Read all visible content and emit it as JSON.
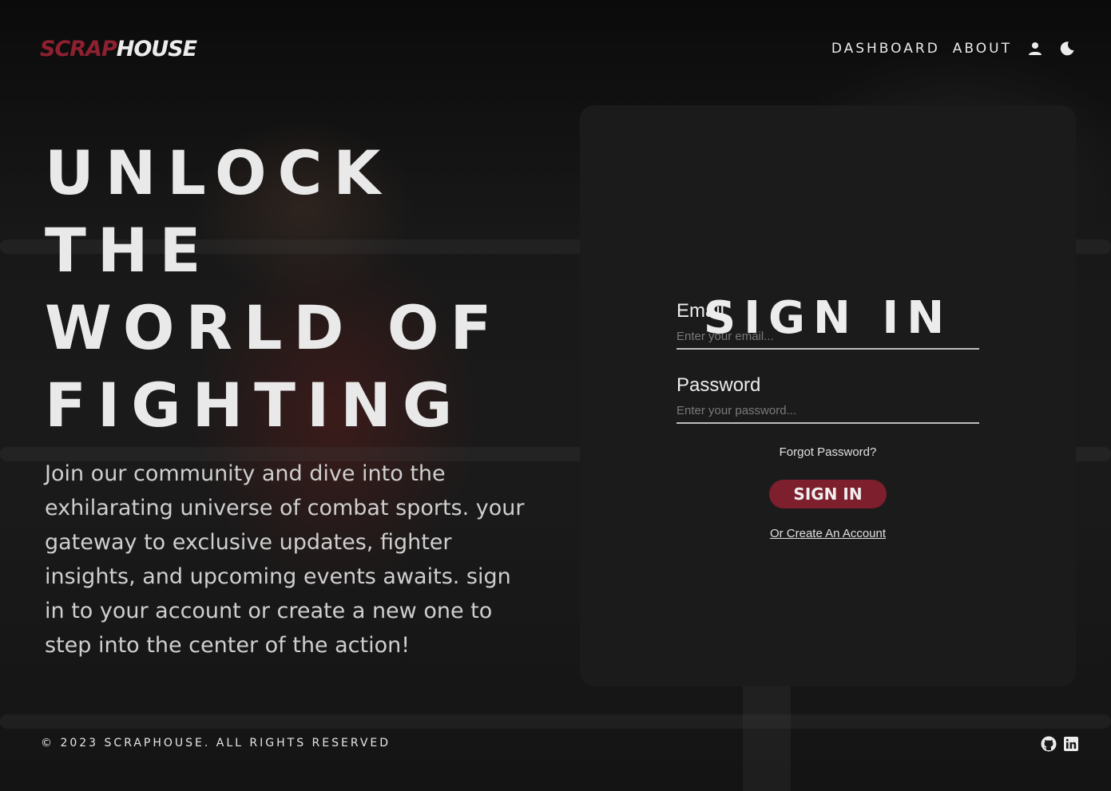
{
  "header": {
    "logo_part1": "SCRAP",
    "logo_part2": "HOUSE",
    "nav": {
      "dashboard_label": "DASHBOARD",
      "about_label": "ABOUT",
      "profile_icon": "user-icon",
      "theme_icon": "moon-icon"
    }
  },
  "hero": {
    "title_lines": [
      "UNLOCK",
      "THE",
      "WORLD OF",
      "FIGHTING"
    ],
    "description": "Join our community and dive into the exhilarating universe of combat sports. your gateway to exclusive updates, fighter insights, and upcoming events awaits. sign in to your account or create a new one to step into the center of the action!"
  },
  "signin": {
    "title": "SIGN IN",
    "email_label": "Email",
    "email_placeholder": "Enter your email...",
    "email_value": "",
    "password_label": "Password",
    "password_placeholder": "Enter your password...",
    "password_value": "",
    "forgot_label": "Forgot Password?",
    "submit_label": "SIGN IN",
    "create_label": "Or Create An Account"
  },
  "footer": {
    "copyright": "© 2023 SCRAPHOUSE. ALL RIGHTS RESERVED",
    "icons": [
      "github-icon",
      "linkedin-icon"
    ]
  },
  "colors": {
    "accent": "#7d1f2c",
    "logo_red": "#8f2030",
    "card_bg": "#1b1b1b",
    "text_light": "#ececec"
  }
}
